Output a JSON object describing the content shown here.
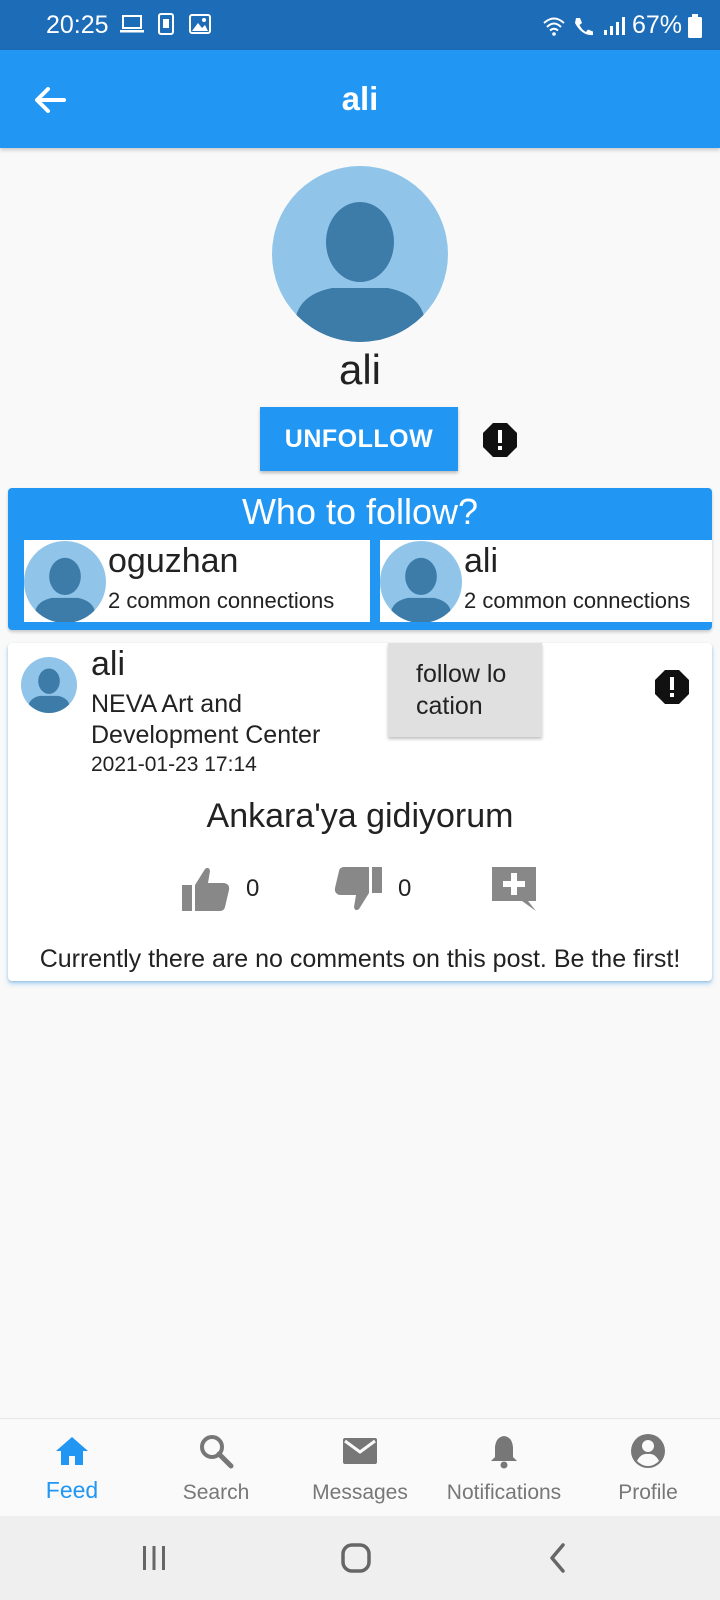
{
  "status_bar": {
    "time": "20:25",
    "battery": "67%",
    "left_icons": [
      "laptop-icon",
      "sim-icon",
      "image-icon"
    ],
    "right_icons": [
      "wifi-icon",
      "wifi-call-icon",
      "signal-icon",
      "battery-icon"
    ]
  },
  "app_bar": {
    "title": "ali",
    "back_icon": "arrow-left-icon"
  },
  "profile": {
    "name": "ali",
    "unfollow_label": "UNFOLLOW",
    "report_icon": "report-icon"
  },
  "who_to_follow": {
    "title": "Who to follow?",
    "suggestions": [
      {
        "name": "oguzhan",
        "subtitle": "2 common connections"
      },
      {
        "name": "ali",
        "subtitle": "2 common connections"
      }
    ]
  },
  "post": {
    "author": "ali",
    "location": "NEVA Art and Development Center",
    "date": "2021-01-23 17:14",
    "follow_location_label": "follow location",
    "text": "Ankara'ya gidiyorum",
    "likes": "0",
    "dislikes": "0",
    "no_comments_text": "Currently there are no comments on this post. Be the first!"
  },
  "bottom_nav": {
    "items": [
      {
        "label": "Feed",
        "icon": "home-icon",
        "active": true
      },
      {
        "label": "Search",
        "icon": "search-icon",
        "active": false
      },
      {
        "label": "Messages",
        "icon": "mail-icon",
        "active": false
      },
      {
        "label": "Notifications",
        "icon": "bell-icon",
        "active": false
      },
      {
        "label": "Profile",
        "icon": "account-icon",
        "active": false
      }
    ]
  },
  "colors": {
    "primary": "#2196f3",
    "status_bar": "#1c6cb8",
    "avatar_bg": "#90c5e9",
    "avatar_fg": "#3d7ba8"
  }
}
